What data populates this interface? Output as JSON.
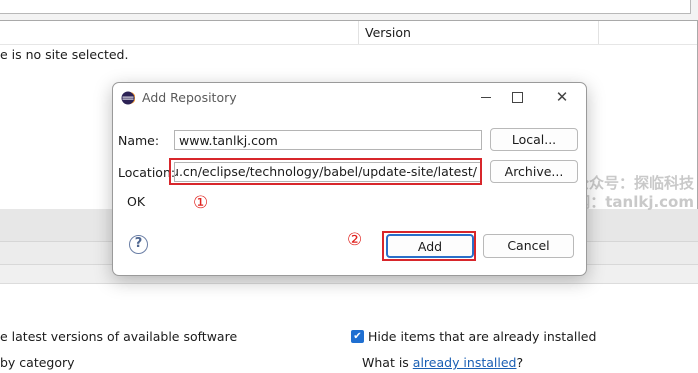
{
  "background": {
    "table_header_version": "Version",
    "no_site_text": "e is no site selected.",
    "option_latest": "e latest versions of available software",
    "option_category": "by category",
    "hide_installed_label": "Hide items that are already installed",
    "hide_installed_checked": true,
    "what_is_prefix": "What is ",
    "what_is_link": "already installed",
    "what_is_suffix": "?"
  },
  "watermark": {
    "line1": "微信公众号：探临科技",
    "line2": "官网：tanlkj.com"
  },
  "dialog": {
    "title": "Add Repository",
    "name_label": "Name:",
    "name_value": "www.tanlkj.com",
    "location_label": "Location:",
    "location_value": "edu.cn/eclipse/technology/babel/update-site/latest/",
    "local_button": "Local...",
    "archive_button": "Archive...",
    "status": "OK",
    "marker_1": "①",
    "marker_2": "②",
    "help_symbol": "?",
    "add_button": "Add",
    "cancel_button": "Cancel"
  },
  "colors": {
    "highlight": "#d8262b",
    "link": "#1a5fb4",
    "default_button_border": "#2a6fc9"
  }
}
